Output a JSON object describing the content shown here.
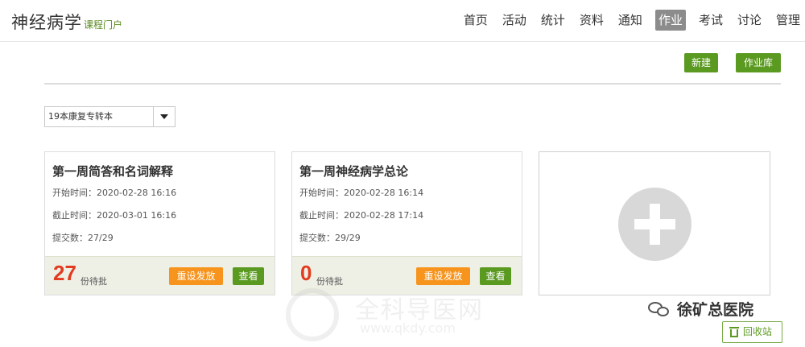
{
  "header": {
    "title": "神经病学",
    "subtitle": "课程门户",
    "nav": [
      "首页",
      "活动",
      "统计",
      "资料",
      "通知",
      "作业",
      "考试",
      "讨论",
      "管理"
    ],
    "active_nav": "作业"
  },
  "toolbar": {
    "new_label": "新建",
    "library_label": "作业库"
  },
  "class_select": {
    "value": "19本康复专转本"
  },
  "assignments": [
    {
      "title": "第一周简答和名词解释",
      "start": "开始时间：2020-02-28 16:16",
      "end": "截止时间：2020-03-01 16:16",
      "submitted": "提交数：27/29",
      "pending_count": "27",
      "pending_label": "份待批",
      "redo_label": "重设发放",
      "view_label": "查看"
    },
    {
      "title": "第一周神经病学总论",
      "start": "开始时间：2020-02-28 16:14",
      "end": "截止时间：2020-02-28 17:14",
      "submitted": "提交数：29/29",
      "pending_count": "0",
      "pending_label": "份待批",
      "redo_label": "重设发放",
      "view_label": "查看"
    }
  ],
  "add_card": {
    "icon": "plus-icon"
  },
  "watermark": {
    "text": "全科导医网",
    "url": "www.qkdy.com"
  },
  "wechat": {
    "account": "徐矿总医院",
    "icon": "wechat-icon"
  },
  "recycle": {
    "label": "回收站",
    "icon": "trash-icon"
  },
  "colors": {
    "green": "#5b9a21",
    "orange": "#f7941d",
    "red": "#e23b1f",
    "active_nav_bg": "#8c8c8c"
  }
}
